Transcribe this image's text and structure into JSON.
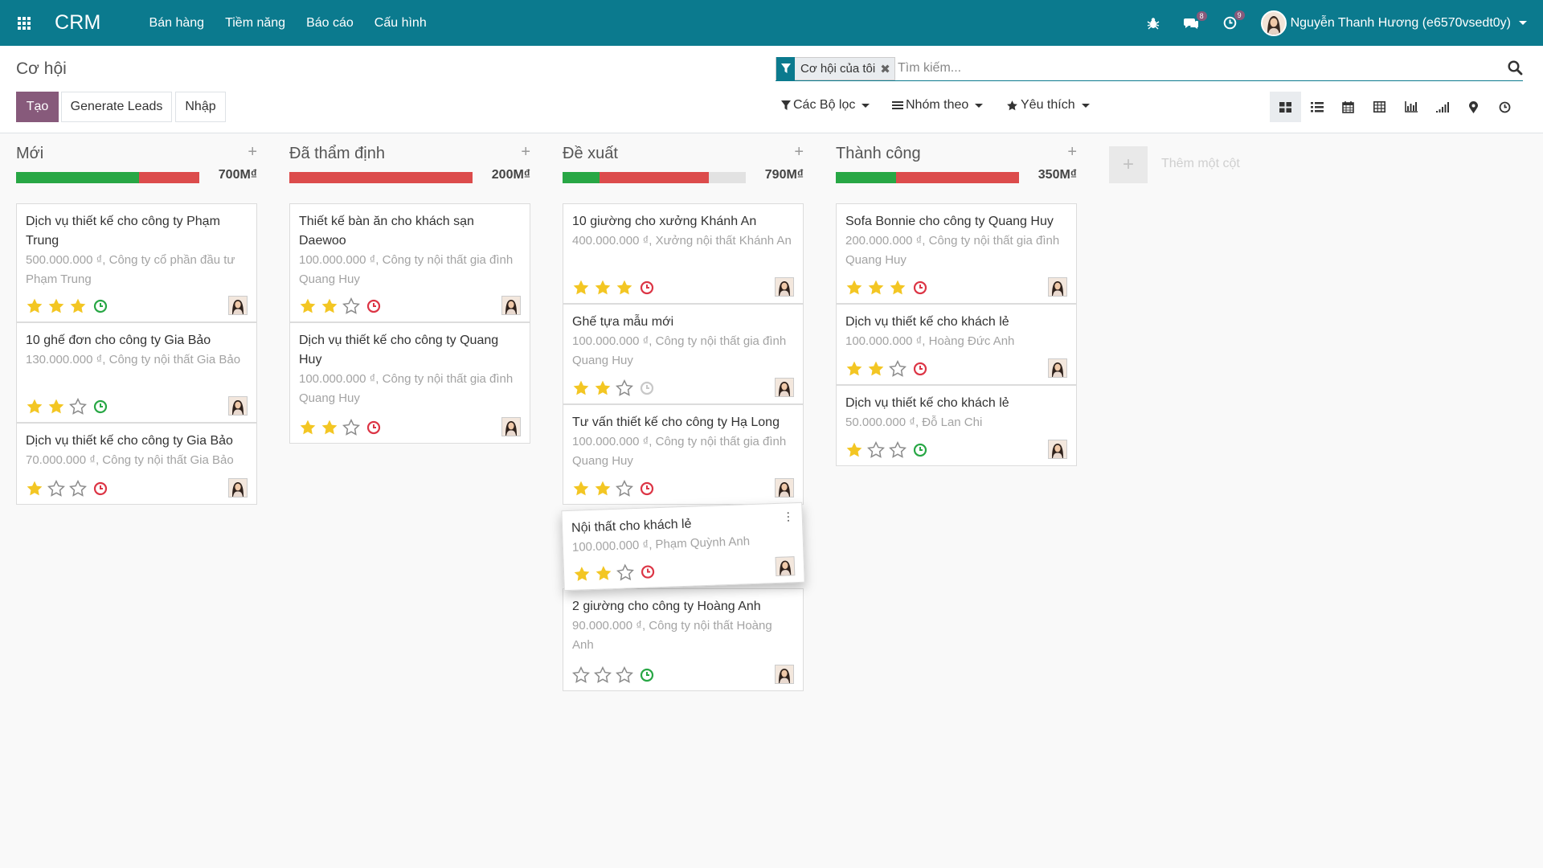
{
  "navbar": {
    "brand": "CRM",
    "menu": [
      "Bán hàng",
      "Tiềm năng",
      "Báo cáo",
      "Cấu hình"
    ],
    "messages_count": "8",
    "activities_count": "9",
    "user_name": "Nguyễn Thanh Hương (e6570vsedt0y)",
    "icons": [
      "apps-icon",
      "bug-icon",
      "chat-icon",
      "clock-icon",
      "chevron-down-icon"
    ]
  },
  "control": {
    "title": "Cơ hội",
    "create_label": "Tạo",
    "generate_label": "Generate Leads",
    "import_label": "Nhập",
    "facet_label": "Cơ hội của tôi",
    "search_placeholder": "Tìm kiếm...",
    "filters_label": "Các Bộ lọc",
    "groupby_label": "Nhóm theo",
    "favorites_label": "Yêu thích",
    "views": [
      "kanban",
      "list",
      "calendar",
      "pivot",
      "graph",
      "cohort",
      "map",
      "activity"
    ]
  },
  "columns": [
    {
      "title": "Mới",
      "total": "700M₫",
      "progress": {
        "green": 0.67,
        "red": 0.33
      },
      "cards": [
        {
          "name": "Dịch vụ thiết kế cho công ty Phạm Trung",
          "sub": "500.000.000 ₫, Công ty cổ phần đầu tư Phạm Trung",
          "stars": 3,
          "clock": "green"
        },
        {
          "name": "10 ghế đơn cho công ty Gia Bảo",
          "sub": "130.000.000 ₫, Công ty nội thất Gia Bảo",
          "stars": 2,
          "clock": "green"
        },
        {
          "name": "Dịch vụ thiết kế cho công ty Gia Bảo",
          "sub": "70.000.000 ₫, Công ty nội thất Gia Bảo",
          "stars": 1,
          "clock": "red"
        }
      ]
    },
    {
      "title": "Đã thẩm định",
      "total": "200M₫",
      "progress": {
        "green": 0,
        "red": 1.0
      },
      "cards": [
        {
          "name": "Thiết kế bàn ăn cho khách sạn Daewoo",
          "sub": "100.000.000 ₫, Công ty nội thất gia đình Quang Huy",
          "stars": 2,
          "clock": "red"
        },
        {
          "name": "Dịch vụ thiết kế cho công ty Quang Huy",
          "sub": "100.000.000 ₫, Công ty nội thất gia đình Quang Huy",
          "stars": 2,
          "clock": "red"
        }
      ]
    },
    {
      "title": "Đề xuất",
      "total": "790M₫",
      "progress": {
        "green": 0.2,
        "red": 0.6
      },
      "cards": [
        {
          "name": "10 giường cho xưởng Khánh An",
          "sub": "400.000.000 ₫, Xưởng nội thất Khánh An",
          "stars": 3,
          "clock": "red"
        },
        {
          "name": "Ghế tựa mẫu mới",
          "sub": "100.000.000 ₫, Công ty nội thất gia đình Quang Huy",
          "stars": 2,
          "clock": "grey"
        },
        {
          "name": "Tư vấn thiết kế cho công ty Hạ Long",
          "sub": "100.000.000 ₫, Công ty nội thất gia đình Quang Huy",
          "stars": 2,
          "clock": "red"
        },
        {
          "name": "Nội thất cho khách lẻ",
          "sub": "100.000.000 ₫, Phạm Quỳnh Anh",
          "stars": 2,
          "clock": "red"
        },
        {
          "name": "2 giường cho công ty Hoàng Anh",
          "sub": "90.000.000 ₫, Công ty nội thất Hoàng Anh",
          "stars": 0,
          "clock": "green"
        }
      ]
    },
    {
      "title": "Thành công",
      "total": "350M₫",
      "progress": {
        "green": 0.33,
        "red": 0.67
      },
      "cards": [
        {
          "name": "Sofa Bonnie cho công ty Quang Huy",
          "sub": "200.000.000 ₫, Công ty nội thất gia đình Quang Huy",
          "stars": 3,
          "clock": "red"
        },
        {
          "name": "Dịch vụ thiết kế cho khách lẻ",
          "sub": "100.000.000 ₫, Hoàng Đức Anh",
          "stars": 2,
          "clock": "red"
        },
        {
          "name": "Dịch vụ thiết kế cho khách lẻ",
          "sub": "50.000.000 ₫, Đỗ Lan Chi",
          "stars": 1,
          "clock": "green"
        }
      ]
    }
  ],
  "add_column_label": "Thêm một cột",
  "colors": {
    "brand": "#0b7a8e",
    "primary": "#875a7b",
    "star_on": "#f3c623",
    "green": "#28a745",
    "red": "#dc3545"
  }
}
